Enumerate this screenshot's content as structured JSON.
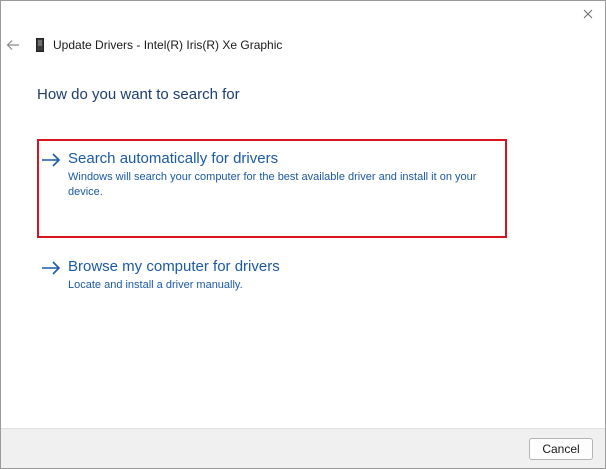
{
  "window": {
    "title": "Update Drivers - Intel(R) Iris(R) Xe Graphic",
    "close_icon": "close-icon",
    "back_icon": "back-arrow-icon",
    "device_icon": "device-icon"
  },
  "main": {
    "question": "How do you want to search for",
    "options": [
      {
        "title": "Search automatically for drivers",
        "description": "Windows will search your computer for the best available driver and install it on your device.",
        "icon": "arrow-right-icon",
        "highlighted": true
      },
      {
        "title": "Browse my computer for drivers",
        "description": "Locate and install a driver manually.",
        "icon": "arrow-right-icon",
        "highlighted": false
      }
    ]
  },
  "footer": {
    "cancel_label": "Cancel"
  },
  "colors": {
    "link": "#1b5aa6",
    "heading": "#1c3d73",
    "highlight": "#d7141f",
    "footer_bg": "#f0f0f0"
  }
}
